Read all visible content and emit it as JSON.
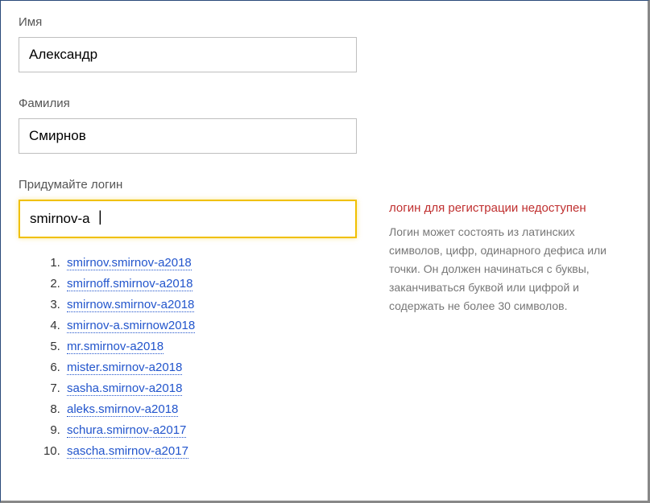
{
  "firstName": {
    "label": "Имя",
    "value": "Александр"
  },
  "lastName": {
    "label": "Фамилия",
    "value": "Смирнов"
  },
  "login": {
    "label": "Придумайте логин",
    "value": "smirnov-a"
  },
  "error": {
    "title": "логин для регистрации недоступен",
    "hint": "Логин может состоять из латинских символов, цифр, одинарного дефиса или точки. Он должен начинаться с буквы, заканчиваться буквой или цифрой и содержать не более 30 символов."
  },
  "suggestions": [
    "smirnov.smirnov-a2018",
    "smirnoff.smirnov-a2018",
    "smirnow.smirnov-a2018",
    "smirnov-a.smirnow2018",
    "mr.smirnov-a2018",
    "mister.smirnov-a2018",
    "sasha.smirnov-a2018",
    "aleks.smirnov-a2018",
    "schura.smirnov-a2017",
    "sascha.smirnov-a2017"
  ]
}
